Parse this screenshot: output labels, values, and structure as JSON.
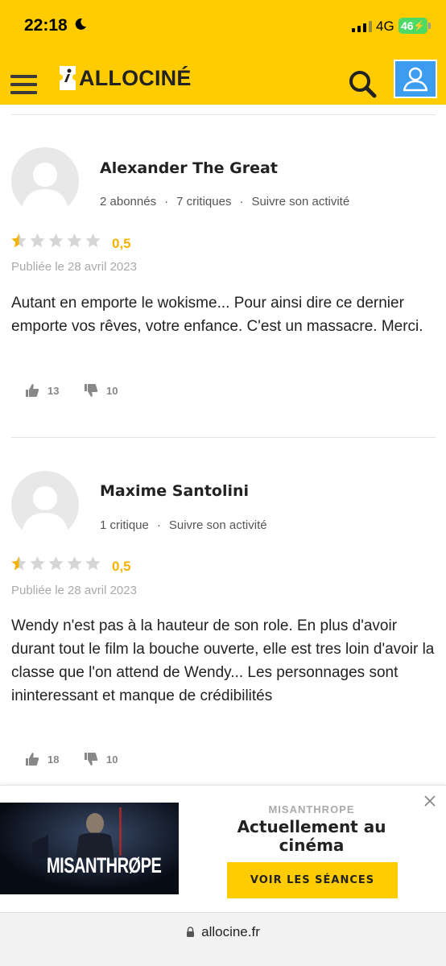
{
  "status": {
    "time": "22:18",
    "network": "4G",
    "battery": "46"
  },
  "header": {
    "logo": "ALLOCINÉ"
  },
  "reviews": [
    {
      "author": "Alexander The Great",
      "subscribers": "2 abonnés",
      "critiques": "7 critiques",
      "follow": "Suivre son activité",
      "rating": "0,5",
      "date": "Publiée le 28 avril 2023",
      "text": "Autant en emporte le wokisme... Pour ainsi dire ce dernier emporte vos rêves, votre enfance. C'est un massacre. Merci.",
      "likes": "13",
      "dislikes": "10"
    },
    {
      "author": "Maxime Santolini",
      "critiques": "1 critique",
      "follow": "Suivre son activité",
      "rating": "0,5",
      "date": "Publiée le 28 avril 2023",
      "text": "Wendy n'est pas à la hauteur de son role. En plus d'avoir durant tout le film la bouche ouverte, elle est tres loin d'avoir la classe que l'on attend de Wendy... Les personnages sont ininteressant et manque de crédibilités",
      "likes": "18",
      "dislikes": "10"
    }
  ],
  "ad": {
    "poster_title": "MISANTHRØPE",
    "film": "MISANTHROPE",
    "title": "Actuellement au cinéma",
    "cta": "VOIR LES SÉANCES"
  },
  "browser": {
    "url": "allocine.fr"
  },
  "colors": {
    "brand_yellow": "#fecc00",
    "star_gold": "#f2b300",
    "user_blue": "#3b9cf0"
  }
}
